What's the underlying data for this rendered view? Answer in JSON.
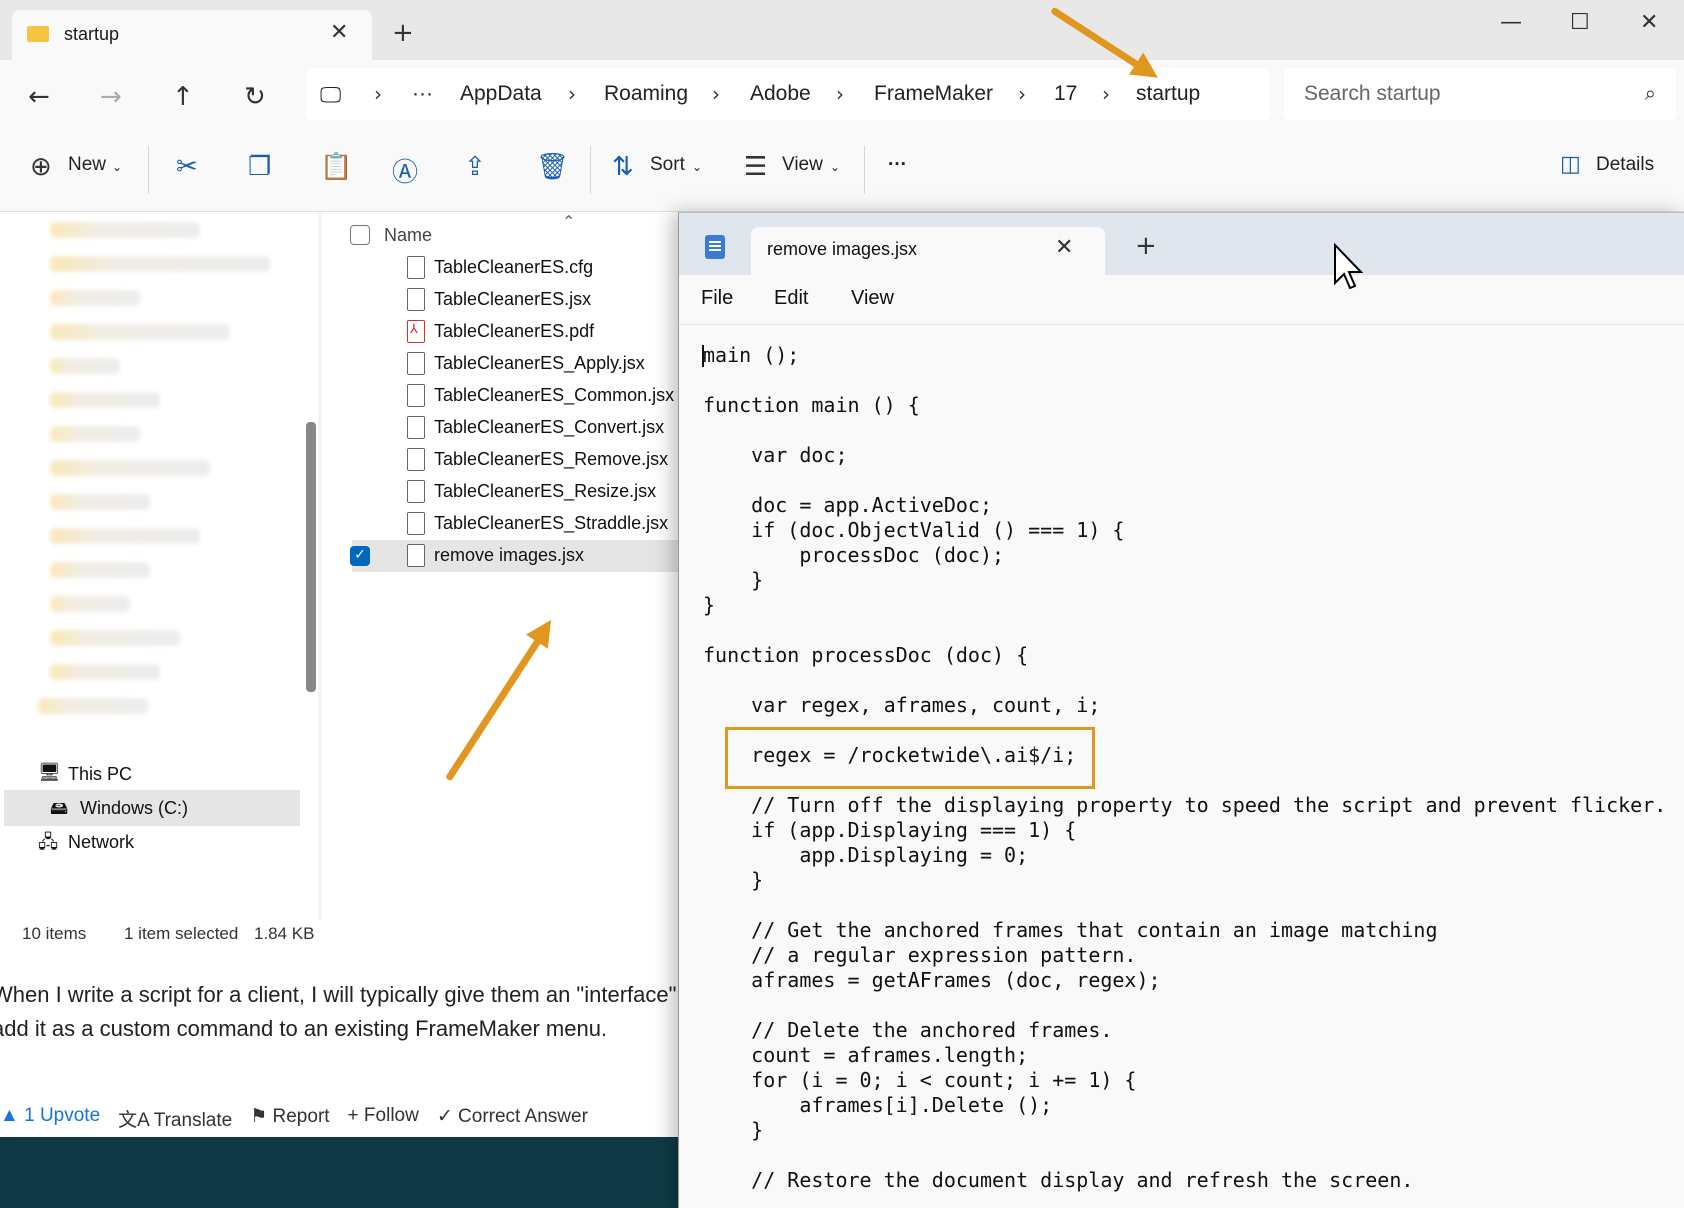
{
  "explorer": {
    "tab_title": "startup",
    "breadcrumb": [
      "AppData",
      "Roaming",
      "Adobe",
      "FrameMaker",
      "17",
      "startup"
    ],
    "search_placeholder": "Search startup",
    "toolbar": {
      "new_label": "New",
      "sort_label": "Sort",
      "view_label": "View",
      "details_label": "Details"
    },
    "nav_items": [
      "This PC",
      "Windows (C:)",
      "Network"
    ],
    "column_name": "Name",
    "files": [
      {
        "name": "TableCleanerES.cfg",
        "type": "file"
      },
      {
        "name": "TableCleanerES.jsx",
        "type": "file"
      },
      {
        "name": "TableCleanerES.pdf",
        "type": "pdf"
      },
      {
        "name": "TableCleanerES_Apply.jsx",
        "type": "file"
      },
      {
        "name": "TableCleanerES_Common.jsx",
        "type": "file"
      },
      {
        "name": "TableCleanerES_Convert.jsx",
        "type": "file"
      },
      {
        "name": "TableCleanerES_Remove.jsx",
        "type": "file"
      },
      {
        "name": "TableCleanerES_Resize.jsx",
        "type": "file"
      },
      {
        "name": "TableCleanerES_Straddle.jsx",
        "type": "file"
      },
      {
        "name": "remove images.jsx",
        "type": "file",
        "selected": true
      }
    ],
    "status": {
      "items": "10 items",
      "selected": "1 item selected",
      "size": "1.84 KB"
    }
  },
  "notepad": {
    "tab_title": "remove images.jsx",
    "menu": [
      "File",
      "Edit",
      "View"
    ],
    "code_lines": [
      "main ();",
      "",
      "function main () {",
      "",
      "    var doc;",
      "",
      "    doc = app.ActiveDoc;",
      "    if (doc.ObjectValid () === 1) {",
      "        processDoc (doc);",
      "    }",
      "}",
      "",
      "function processDoc (doc) {",
      "",
      "    var regex, aframes, count, i;",
      "",
      "    regex = /rocketwide\\.ai$/i;",
      "",
      "    // Turn off the displaying property to speed the script and prevent flicker.",
      "    if (app.Displaying === 1) {",
      "        app.Displaying = 0;",
      "    }",
      "",
      "    // Get the anchored frames that contain an image matching",
      "    // a regular expression pattern.",
      "    aframes = getAFrames (doc, regex);",
      "",
      "    // Delete the anchored frames.",
      "    count = aframes.length;",
      "    for (i = 0; i < count; i += 1) {",
      "        aframes[i].Delete ();",
      "    }",
      "",
      "    // Restore the document display and refresh the screen."
    ]
  },
  "forum": {
    "paragraph_line1": "When I write a script for a client, I will typically give them an \"interface\"",
    "paragraph_line2": "add it as a custom command to an existing FrameMaker menu.",
    "upvote": "1 Upvote",
    "translate": "Translate",
    "report": "Report",
    "follow": "Follow",
    "correct": "Correct Answer"
  },
  "colors": {
    "accent_arrow": "#e0961f",
    "selection_blue": "#0067c0"
  }
}
